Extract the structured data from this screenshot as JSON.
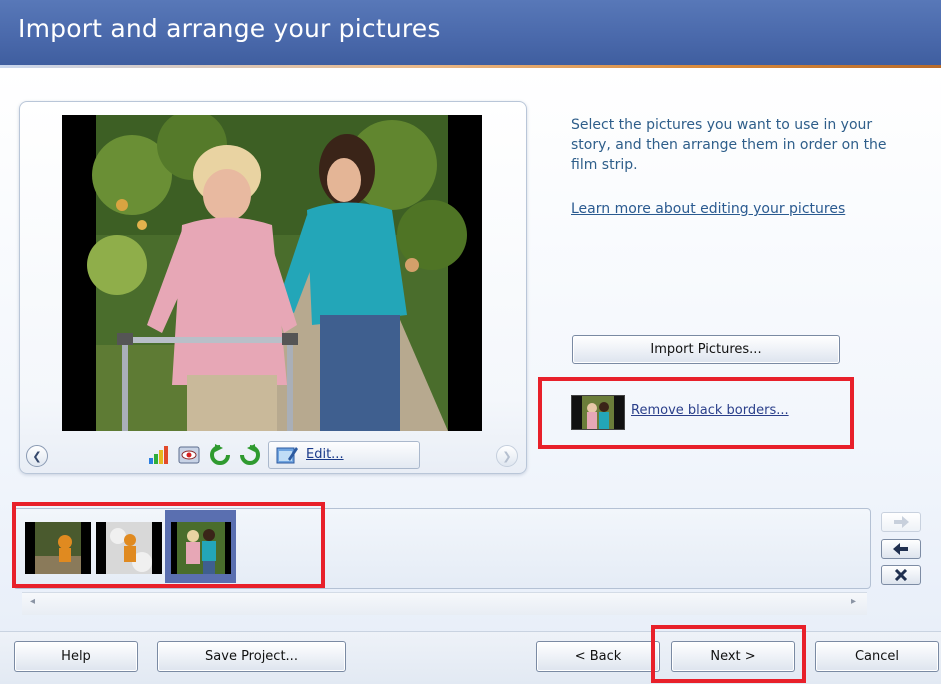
{
  "window": {
    "title": "Import and arrange your pictures"
  },
  "preview": {
    "photo_icon": "photo-two-women-walker",
    "prev_icon": "chevron-left-circle-icon",
    "next_icon": "chevron-right-circle-icon",
    "tools": [
      "color-levels-icon",
      "red-eye-icon",
      "rotate-left-icon",
      "rotate-right-icon",
      "edit-picture-icon"
    ],
    "edit_label": "Edit..."
  },
  "instructions": {
    "text": "Select the pictures you want to use in your story, and then arrange them in order on the film strip.",
    "learn_more": "Learn more about editing your pictures"
  },
  "actions": {
    "import_label": "Import Pictures...",
    "remove_borders_label": "Remove black borders..."
  },
  "filmstrip": {
    "thumbnails": [
      {
        "name": "thumbnail-1",
        "selected": false
      },
      {
        "name": "thumbnail-2",
        "selected": false
      },
      {
        "name": "thumbnail-3",
        "selected": true
      }
    ],
    "side_buttons": [
      "move-right-arrow-icon",
      "move-left-arrow-icon",
      "delete-x-icon"
    ]
  },
  "footer": {
    "help_label": "Help",
    "save_label": "Save Project...",
    "back_label": "< Back",
    "next_label": "Next >",
    "cancel_label": "Cancel"
  },
  "colors": {
    "title_bar": "#4a69ab",
    "highlight": "#e8202a",
    "selected_thumb": "#5a6fb0",
    "link": "#2a5a90"
  }
}
